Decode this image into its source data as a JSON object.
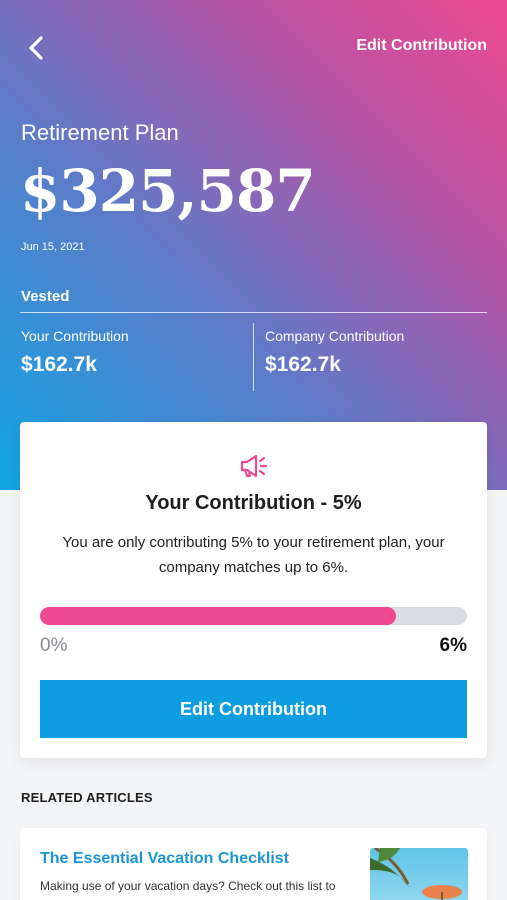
{
  "header": {
    "back_icon": "chevron-left-icon",
    "edit_link": "Edit Contribution"
  },
  "plan": {
    "title": "Retirement Plan",
    "balance": "$325,587",
    "date": "Jun 15, 2021",
    "vested_label": "Vested",
    "your_contribution_label": "Your Contribution",
    "your_contribution_value": "$162.7k",
    "company_contribution_label": "Company Contribution",
    "company_contribution_value": "$162.7k"
  },
  "contribution_card": {
    "icon": "megaphone-icon",
    "title": "Your Contribution - 5%",
    "description": "You are only contributing 5% to your retirement plan, your company matches up to 6%.",
    "progress": {
      "min_label": "0%",
      "max_label": "6%",
      "value_percent": 5,
      "max_percent": 6
    },
    "button_label": "Edit Contribution"
  },
  "related": {
    "heading": "RELATED ARTICLES",
    "articles": [
      {
        "title": "The Essential Vacation Checklist",
        "description": "Making use of your vacation days? Check out this list to",
        "thumbnail": "beach-photo"
      }
    ]
  },
  "colors": {
    "accent_pink": "#ee4a91",
    "accent_blue": "#0d9de0",
    "link_blue": "#1b95d4",
    "gradient_start": "#10a6e3",
    "gradient_end": "#ee4a91"
  }
}
